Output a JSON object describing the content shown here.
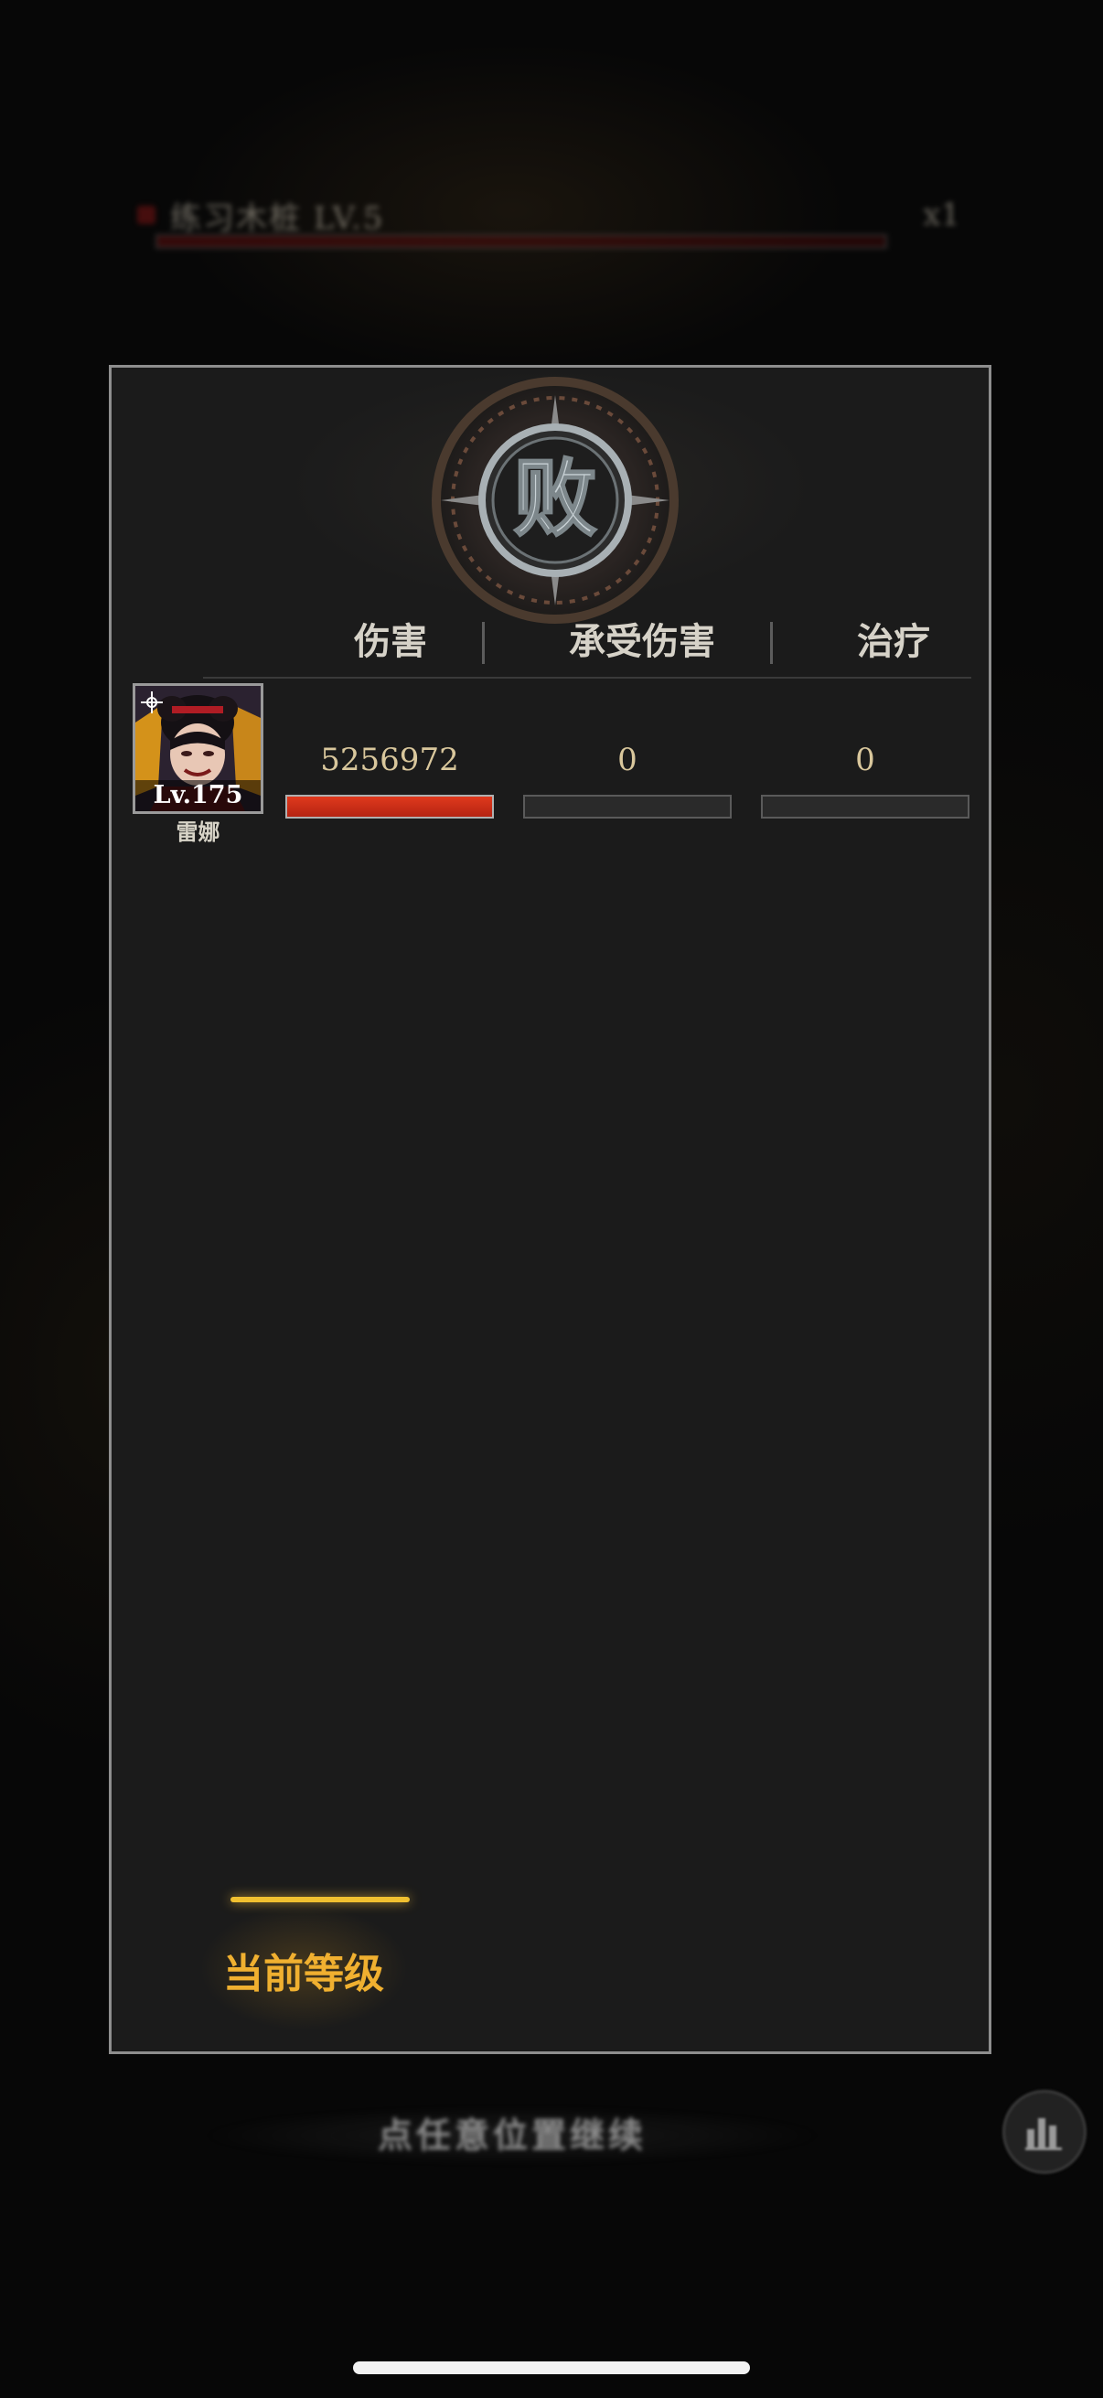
{
  "stage_banner": {
    "name": "练习木桩 LV.5",
    "multiplier": "x1"
  },
  "result": {
    "emblem_text": "败"
  },
  "columns": {
    "damage": "伤害",
    "damage_taken": "承受伤害",
    "healing": "治疗"
  },
  "heroes": [
    {
      "name": "雷娜",
      "level": "Lv.175",
      "damage": "5256972",
      "damage_taken": "0",
      "healing": "0",
      "damage_fraction": 1.0,
      "damage_taken_fraction": 0,
      "healing_fraction": 0
    }
  ],
  "tab": {
    "label": "当前等级"
  },
  "footer": {
    "continue_text": "点任意位置继续",
    "stats_icon": "bar-chart-icon"
  },
  "colors": {
    "damage_bar": "#d4321a",
    "tab_active": "#f0b030",
    "value_text": "#d9c79c"
  }
}
